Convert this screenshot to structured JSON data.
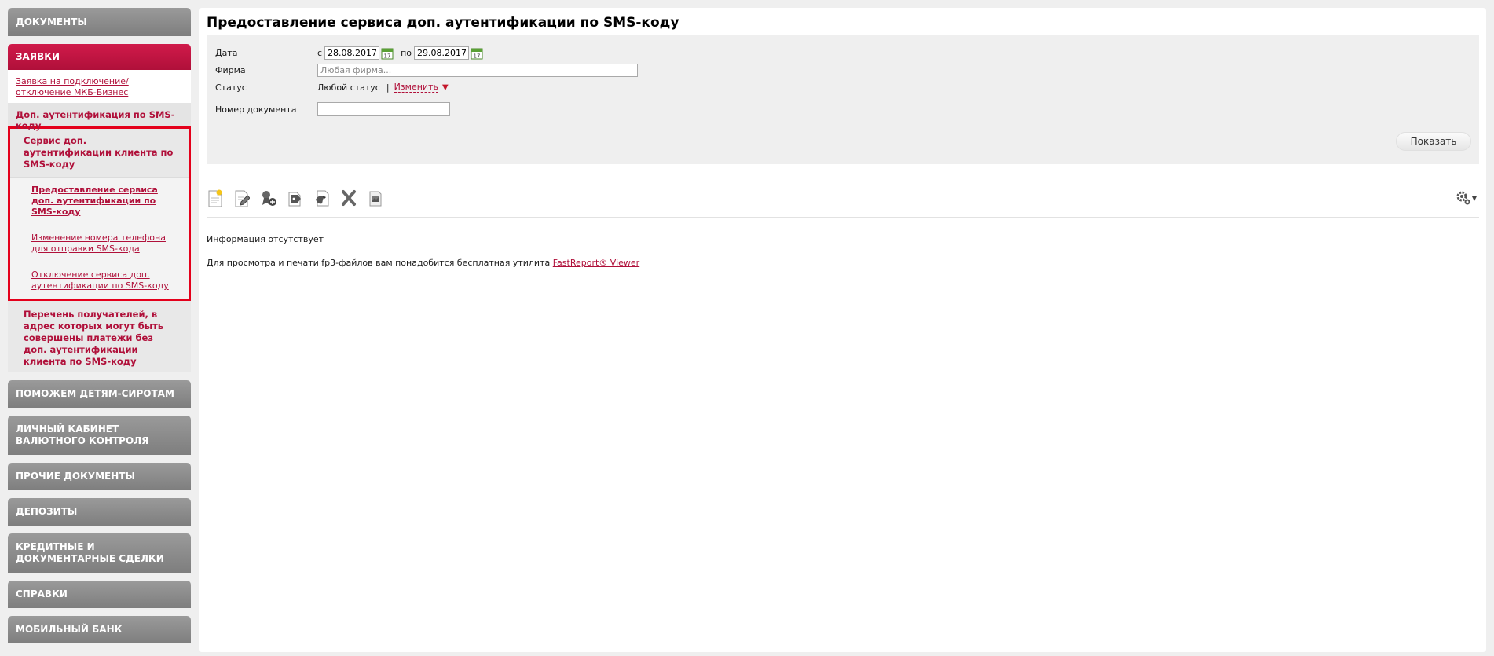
{
  "sidebar": {
    "documents": "ДОКУМЕНТЫ",
    "requests": "ЗАЯВКИ",
    "requests_link": "Заявка на подключение/отключение МКБ-Бизнес",
    "sms_section": "Доп. аутентификация по SMS-коду",
    "service_title": "Сервис доп. аутентификации клиента по SMS-коду",
    "service_links": [
      "Предоставление сервиса доп. аутентификации по SMS-коду",
      "Изменение номера телефона для отправки SMS-кода",
      "Отключение сервиса доп. аутентификации по SMS-коду"
    ],
    "recipients_list": "Перечень получателей, в адрес которых могут быть совершены платежи без доп. аутентификации клиента по SMS-коду",
    "orphans": "ПОМОЖЕМ ДЕТЯМ-СИРОТАМ",
    "currency_control": "ЛИЧНЫЙ КАБИНЕТ ВАЛЮТНОГО КОНТРОЛЯ",
    "other_docs": "ПРОЧИЕ ДОКУМЕНТЫ",
    "deposits": "ДЕПОЗИТЫ",
    "credit_deals": "КРЕДИТНЫЕ И ДОКУМЕНТАРНЫЕ СДЕЛКИ",
    "references": "СПРАВКИ",
    "mobile_bank": "МОБИЛЬНЫЙ БАНК"
  },
  "main": {
    "title": "Предоставление сервиса доп. аутентификации по SMS-коду",
    "filter": {
      "date_label": "Дата",
      "from_prefix": "с",
      "date_from": "28.08.2017",
      "to_prefix": "по",
      "date_to": "29.08.2017",
      "firm_label": "Фирма",
      "firm_placeholder": "Любая фирма...",
      "status_label": "Статус",
      "status_value": "Любой статус",
      "status_sep": "|",
      "status_change": "Изменить",
      "doc_label": "Номер документа",
      "show_button": "Показать"
    },
    "no_info": "Информация отсутствует",
    "note_text": "Для просмотра и печати fp3-файлов вам понадобится бесплатная утилита",
    "note_link": "FastReport® Viewer"
  }
}
